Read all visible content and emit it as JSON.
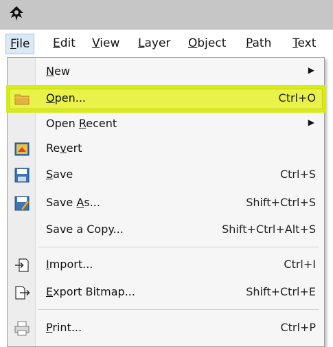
{
  "menubar": {
    "items": [
      {
        "pre": "",
        "acc": "F",
        "post": "ile"
      },
      {
        "pre": "",
        "acc": "E",
        "post": "dit"
      },
      {
        "pre": "",
        "acc": "V",
        "post": "iew"
      },
      {
        "pre": "",
        "acc": "L",
        "post": "ayer"
      },
      {
        "pre": "",
        "acc": "O",
        "post": "bject"
      },
      {
        "pre": "",
        "acc": "P",
        "post": "ath"
      },
      {
        "pre": "",
        "acc": "T",
        "post": "ext"
      }
    ]
  },
  "file_menu": {
    "new": {
      "pre": "",
      "acc": "N",
      "post": "ew"
    },
    "open": {
      "pre": "",
      "acc": "O",
      "post": "pen...",
      "shortcut": "Ctrl+O"
    },
    "open_recent": {
      "pre": "Open ",
      "acc": "R",
      "post": "ecent"
    },
    "revert": {
      "pre": "Re",
      "acc": "v",
      "post": "ert"
    },
    "save": {
      "pre": "",
      "acc": "S",
      "post": "ave",
      "shortcut": "Ctrl+S"
    },
    "save_as": {
      "pre": "Save ",
      "acc": "A",
      "post": "s...",
      "shortcut": "Shift+Ctrl+S"
    },
    "save_copy": {
      "label": "Save a Copy...",
      "shortcut": "Shift+Ctrl+Alt+S"
    },
    "import": {
      "pre": "",
      "acc": "I",
      "post": "mport...",
      "shortcut": "Ctrl+I"
    },
    "export": {
      "pre": "",
      "acc": "E",
      "post": "xport Bitmap...",
      "shortcut": "Shift+Ctrl+E"
    },
    "print": {
      "pre": "",
      "acc": "P",
      "post": "rint...",
      "shortcut": "Ctrl+P"
    }
  },
  "colors": {
    "highlight": "#d9ec1f",
    "folder": "#e3b341"
  },
  "icons": {
    "app": "inkscape-logo-icon",
    "open": "folder-icon",
    "revert": "revert-icon",
    "save": "save-icon",
    "save_as": "save-as-icon",
    "import": "import-icon",
    "export": "export-icon",
    "print": "printer-icon"
  }
}
